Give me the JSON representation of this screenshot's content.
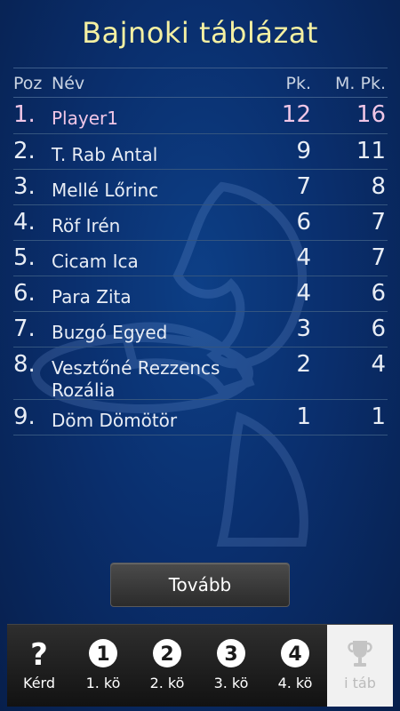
{
  "title": "Bajnoki táblázat",
  "table": {
    "headers": {
      "pos": "Poz",
      "name": "Név",
      "pk": "Pk.",
      "mpk": "M. Pk."
    },
    "rows": [
      {
        "pos": "1.",
        "name": "Player1",
        "pk": "12",
        "mpk": "16"
      },
      {
        "pos": "2.",
        "name": "T. Rab Antal",
        "pk": "9",
        "mpk": "11"
      },
      {
        "pos": "3.",
        "name": "Mellé Lőrinc",
        "pk": "7",
        "mpk": "8"
      },
      {
        "pos": "4.",
        "name": "Röf Irén",
        "pk": "6",
        "mpk": "7"
      },
      {
        "pos": "5.",
        "name": "Cicam Ica",
        "pk": "4",
        "mpk": "7"
      },
      {
        "pos": "6.",
        "name": "Para Zita",
        "pk": "4",
        "mpk": "6"
      },
      {
        "pos": "7.",
        "name": "Buzgó Egyed",
        "pk": "3",
        "mpk": "6"
      },
      {
        "pos": "8.",
        "name": "Vesztőné Rezzencs Rozália",
        "pk": "2",
        "mpk": "4"
      },
      {
        "pos": "9.",
        "name": "Döm Dömötör",
        "pk": "1",
        "mpk": "1"
      }
    ]
  },
  "continue_button": "Tovább",
  "tabs": [
    {
      "label": "Kérd",
      "icon": "question-icon",
      "glyph": "?"
    },
    {
      "label": "1. kö",
      "icon": "round-1-icon",
      "glyph": "1"
    },
    {
      "label": "2. kö",
      "icon": "round-2-icon",
      "glyph": "2"
    },
    {
      "label": "3. kö",
      "icon": "round-3-icon",
      "glyph": "3"
    },
    {
      "label": "4. kö",
      "icon": "round-4-icon",
      "glyph": "4"
    },
    {
      "label": "i táb",
      "icon": "trophy-icon",
      "glyph": ""
    }
  ],
  "colors": {
    "background": "#0a2f6e",
    "title": "#f4f0a2",
    "highlight_row": "#f0c6e6",
    "active_tab_bg": "#f1f1f1"
  }
}
